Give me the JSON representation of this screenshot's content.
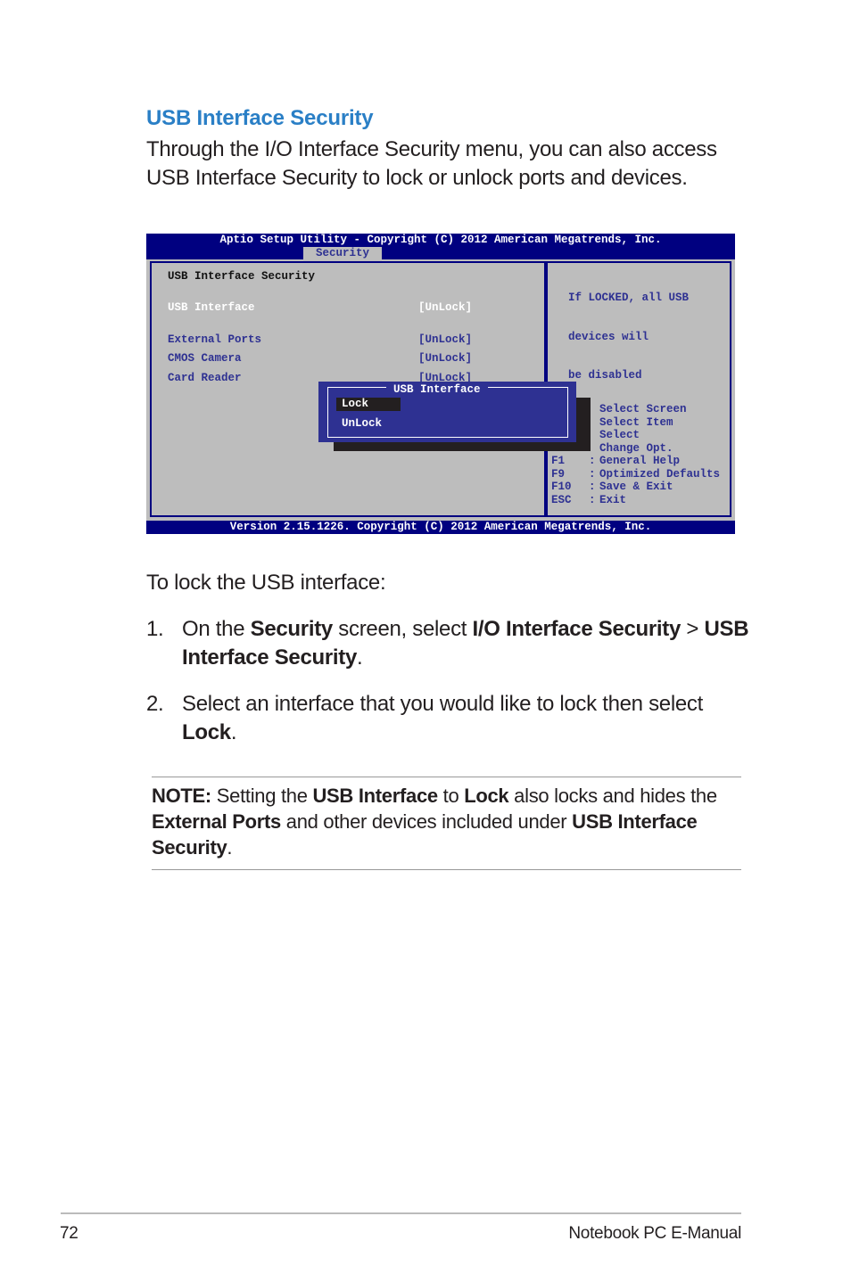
{
  "heading": "USB Interface Security",
  "intro": "Through the I/O Interface Security menu, you can also access USB Interface Security to lock or unlock ports and devices.",
  "intro_lines": [
    "Through the I/O Interface Security menu, you can also access",
    "USB Interface Security to lock or unlock ports and devices."
  ],
  "bios": {
    "title": "Aptio Setup Utility - Copyright (C) 2012 American Megatrends, Inc.",
    "tab": "Security",
    "section_title": "USB Interface Security",
    "items": [
      {
        "label": "USB Interface",
        "value": "[UnLock]"
      },
      {
        "label": "External Ports",
        "value": "[UnLock]"
      },
      {
        "label": "CMOS Camera",
        "value": "[UnLock]"
      },
      {
        "label": "Card Reader",
        "value": "[UnLock]"
      }
    ],
    "help_lines": [
      "If LOCKED, all USB",
      "devices will",
      "be disabled"
    ],
    "popup": {
      "title": "USB Interface",
      "options": [
        "Lock",
        "UnLock"
      ],
      "selected": "Lock"
    },
    "keys": [
      {
        "key": "",
        "desc": "Select Screen"
      },
      {
        "key": "",
        "desc": "Select Item"
      },
      {
        "key": "",
        "desc": "Select"
      },
      {
        "key": "",
        "desc": "Change Opt."
      },
      {
        "key": "F1",
        "desc": "General Help"
      },
      {
        "key": "F9",
        "desc": "Optimized Defaults"
      },
      {
        "key": "F10",
        "desc": "Save & Exit"
      },
      {
        "key": "ESC",
        "desc": "Exit"
      }
    ],
    "footer": "Version 2.15.1226. Copyright (C) 2012 American Megatrends, Inc.",
    "colors": {
      "bar": "#000080",
      "panel": "#bdbdbd",
      "label": "#2e3192",
      "popup": "#2e3192"
    }
  },
  "lock_intro": "To lock the USB interface:",
  "steps": [
    {
      "num": "1.",
      "parts": [
        "On the ",
        "Security",
        " screen, select ",
        "I/O Interface Security",
        " > ",
        "USB",
        "Interface Security",
        "."
      ]
    },
    {
      "num": "2.",
      "parts": [
        "Select an interface that you would like to lock then select",
        "Lock",
        "."
      ]
    }
  ],
  "note": {
    "parts": [
      "NOTE:",
      " Setting the ",
      "USB Interface",
      " to ",
      "Lock",
      " also locks and hides the",
      "External Ports",
      " and other devices included under ",
      "USB Interface",
      "Security",
      "."
    ]
  },
  "footer": {
    "page_number": "72",
    "manual_title": "Notebook PC E-Manual"
  }
}
